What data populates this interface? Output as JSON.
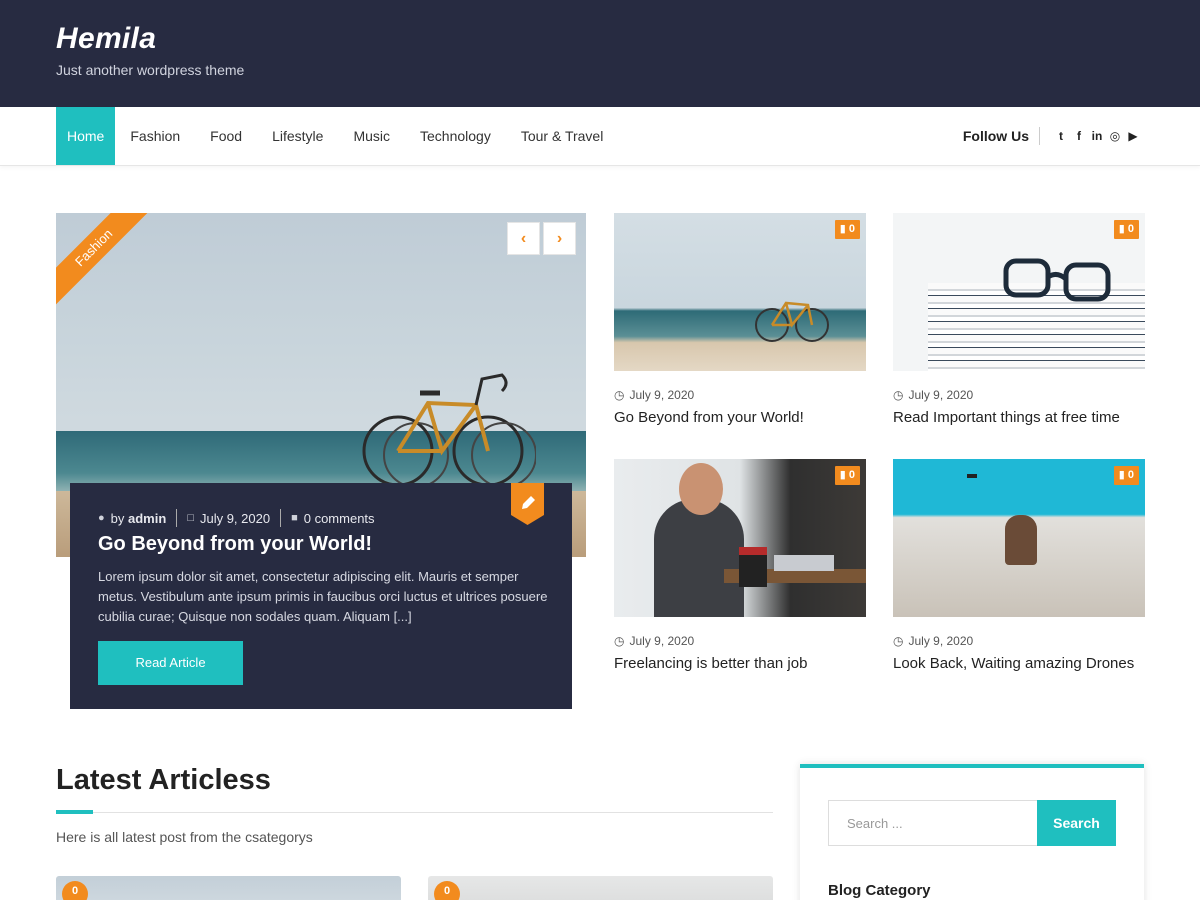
{
  "header": {
    "site_title": "Hemila",
    "tagline": "Just another wordpress theme"
  },
  "nav": {
    "items": [
      {
        "label": "Home",
        "active": true
      },
      {
        "label": "Fashion"
      },
      {
        "label": "Food"
      },
      {
        "label": "Lifestyle"
      },
      {
        "label": "Music"
      },
      {
        "label": "Technology"
      },
      {
        "label": "Tour & Travel"
      }
    ],
    "follow_label": "Follow Us",
    "social": [
      {
        "icon": "twitter-icon",
        "glyph": "t"
      },
      {
        "icon": "facebook-icon",
        "glyph": "f"
      },
      {
        "icon": "linkedin-icon",
        "glyph": "in"
      },
      {
        "icon": "dribbble-icon",
        "glyph": "◎"
      },
      {
        "icon": "youtube-icon",
        "glyph": "▶"
      }
    ]
  },
  "featured": {
    "category": "Fashion",
    "prev_glyph": "‹",
    "next_glyph": "›",
    "author_prefix": "by",
    "author": "admin",
    "date": "July 9, 2020",
    "comments": "0 comments",
    "title": "Go Beyond from your World!",
    "excerpt": "Lorem ipsum dolor sit amet, consectetur adipiscing elit. Mauris et semper metus. Vestibulum ante ipsum primis in faucibus orci luctus et ultrices posuere cubilia curae; Quisque non sodales quam. Aliquam [...]",
    "read_label": "Read Article"
  },
  "posts": [
    {
      "title": "Go Beyond from your World!",
      "date": "July 9, 2020",
      "comments": "0"
    },
    {
      "title": "Read Important things at free time",
      "date": "July 9, 2020",
      "comments": "0"
    },
    {
      "title": "Freelancing is better than job",
      "date": "July 9, 2020",
      "comments": "0"
    },
    {
      "title": "Look Back, Waiting amazing Drones",
      "date": "July 9, 2020",
      "comments": "0"
    }
  ],
  "latest": {
    "title": "Latest Articless",
    "subtitle": "Here is all latest post from the csategorys",
    "card_comments": [
      "0",
      "0"
    ]
  },
  "sidebar": {
    "search_placeholder": "Search ...",
    "search_button": "Search",
    "blog_category": "Blog Category"
  },
  "colors": {
    "header_bg": "#272b41",
    "accent": "#1fbfbf",
    "orange": "#f28b1e"
  }
}
